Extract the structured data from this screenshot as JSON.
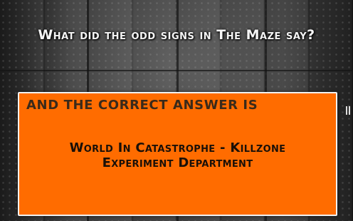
{
  "question": "What did the odd signs in The Maze say?",
  "answer": {
    "header": "AND THE CORRECT ANSWER IS",
    "line1": "World In Catastrophe - Killzone",
    "line2": "Experiment Department"
  },
  "colors": {
    "answer_bg": "#ff6c00",
    "answer_border": "#f2f2f2",
    "question_text": "#f4f4f4"
  },
  "icons": {
    "pause": "pause-icon"
  }
}
